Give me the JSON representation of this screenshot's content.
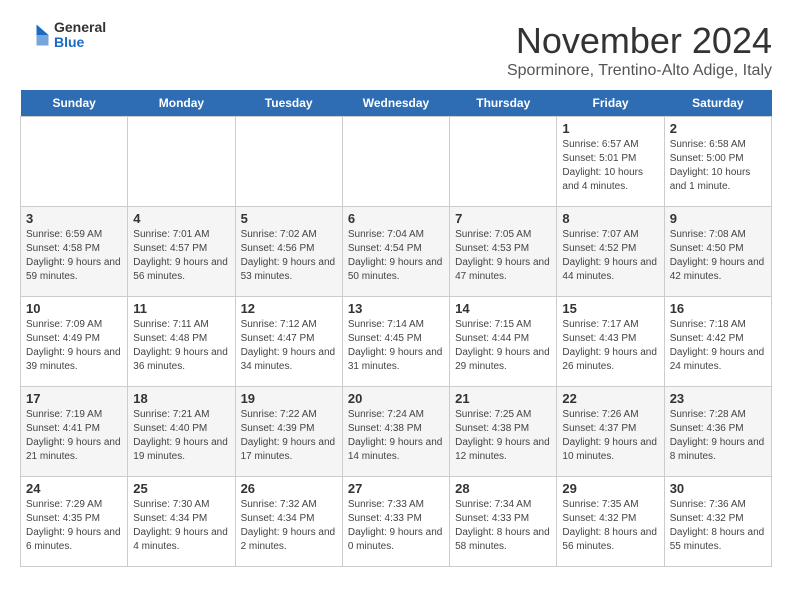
{
  "header": {
    "logo_general": "General",
    "logo_blue": "Blue",
    "month": "November 2024",
    "location": "Sporminore, Trentino-Alto Adige, Italy"
  },
  "weekdays": [
    "Sunday",
    "Monday",
    "Tuesday",
    "Wednesday",
    "Thursday",
    "Friday",
    "Saturday"
  ],
  "weeks": [
    [
      {
        "day": "",
        "info": ""
      },
      {
        "day": "",
        "info": ""
      },
      {
        "day": "",
        "info": ""
      },
      {
        "day": "",
        "info": ""
      },
      {
        "day": "",
        "info": ""
      },
      {
        "day": "1",
        "info": "Sunrise: 6:57 AM\nSunset: 5:01 PM\nDaylight: 10 hours and 4 minutes."
      },
      {
        "day": "2",
        "info": "Sunrise: 6:58 AM\nSunset: 5:00 PM\nDaylight: 10 hours and 1 minute."
      }
    ],
    [
      {
        "day": "3",
        "info": "Sunrise: 6:59 AM\nSunset: 4:58 PM\nDaylight: 9 hours and 59 minutes."
      },
      {
        "day": "4",
        "info": "Sunrise: 7:01 AM\nSunset: 4:57 PM\nDaylight: 9 hours and 56 minutes."
      },
      {
        "day": "5",
        "info": "Sunrise: 7:02 AM\nSunset: 4:56 PM\nDaylight: 9 hours and 53 minutes."
      },
      {
        "day": "6",
        "info": "Sunrise: 7:04 AM\nSunset: 4:54 PM\nDaylight: 9 hours and 50 minutes."
      },
      {
        "day": "7",
        "info": "Sunrise: 7:05 AM\nSunset: 4:53 PM\nDaylight: 9 hours and 47 minutes."
      },
      {
        "day": "8",
        "info": "Sunrise: 7:07 AM\nSunset: 4:52 PM\nDaylight: 9 hours and 44 minutes."
      },
      {
        "day": "9",
        "info": "Sunrise: 7:08 AM\nSunset: 4:50 PM\nDaylight: 9 hours and 42 minutes."
      }
    ],
    [
      {
        "day": "10",
        "info": "Sunrise: 7:09 AM\nSunset: 4:49 PM\nDaylight: 9 hours and 39 minutes."
      },
      {
        "day": "11",
        "info": "Sunrise: 7:11 AM\nSunset: 4:48 PM\nDaylight: 9 hours and 36 minutes."
      },
      {
        "day": "12",
        "info": "Sunrise: 7:12 AM\nSunset: 4:47 PM\nDaylight: 9 hours and 34 minutes."
      },
      {
        "day": "13",
        "info": "Sunrise: 7:14 AM\nSunset: 4:45 PM\nDaylight: 9 hours and 31 minutes."
      },
      {
        "day": "14",
        "info": "Sunrise: 7:15 AM\nSunset: 4:44 PM\nDaylight: 9 hours and 29 minutes."
      },
      {
        "day": "15",
        "info": "Sunrise: 7:17 AM\nSunset: 4:43 PM\nDaylight: 9 hours and 26 minutes."
      },
      {
        "day": "16",
        "info": "Sunrise: 7:18 AM\nSunset: 4:42 PM\nDaylight: 9 hours and 24 minutes."
      }
    ],
    [
      {
        "day": "17",
        "info": "Sunrise: 7:19 AM\nSunset: 4:41 PM\nDaylight: 9 hours and 21 minutes."
      },
      {
        "day": "18",
        "info": "Sunrise: 7:21 AM\nSunset: 4:40 PM\nDaylight: 9 hours and 19 minutes."
      },
      {
        "day": "19",
        "info": "Sunrise: 7:22 AM\nSunset: 4:39 PM\nDaylight: 9 hours and 17 minutes."
      },
      {
        "day": "20",
        "info": "Sunrise: 7:24 AM\nSunset: 4:38 PM\nDaylight: 9 hours and 14 minutes."
      },
      {
        "day": "21",
        "info": "Sunrise: 7:25 AM\nSunset: 4:38 PM\nDaylight: 9 hours and 12 minutes."
      },
      {
        "day": "22",
        "info": "Sunrise: 7:26 AM\nSunset: 4:37 PM\nDaylight: 9 hours and 10 minutes."
      },
      {
        "day": "23",
        "info": "Sunrise: 7:28 AM\nSunset: 4:36 PM\nDaylight: 9 hours and 8 minutes."
      }
    ],
    [
      {
        "day": "24",
        "info": "Sunrise: 7:29 AM\nSunset: 4:35 PM\nDaylight: 9 hours and 6 minutes."
      },
      {
        "day": "25",
        "info": "Sunrise: 7:30 AM\nSunset: 4:34 PM\nDaylight: 9 hours and 4 minutes."
      },
      {
        "day": "26",
        "info": "Sunrise: 7:32 AM\nSunset: 4:34 PM\nDaylight: 9 hours and 2 minutes."
      },
      {
        "day": "27",
        "info": "Sunrise: 7:33 AM\nSunset: 4:33 PM\nDaylight: 9 hours and 0 minutes."
      },
      {
        "day": "28",
        "info": "Sunrise: 7:34 AM\nSunset: 4:33 PM\nDaylight: 8 hours and 58 minutes."
      },
      {
        "day": "29",
        "info": "Sunrise: 7:35 AM\nSunset: 4:32 PM\nDaylight: 8 hours and 56 minutes."
      },
      {
        "day": "30",
        "info": "Sunrise: 7:36 AM\nSunset: 4:32 PM\nDaylight: 8 hours and 55 minutes."
      }
    ]
  ]
}
